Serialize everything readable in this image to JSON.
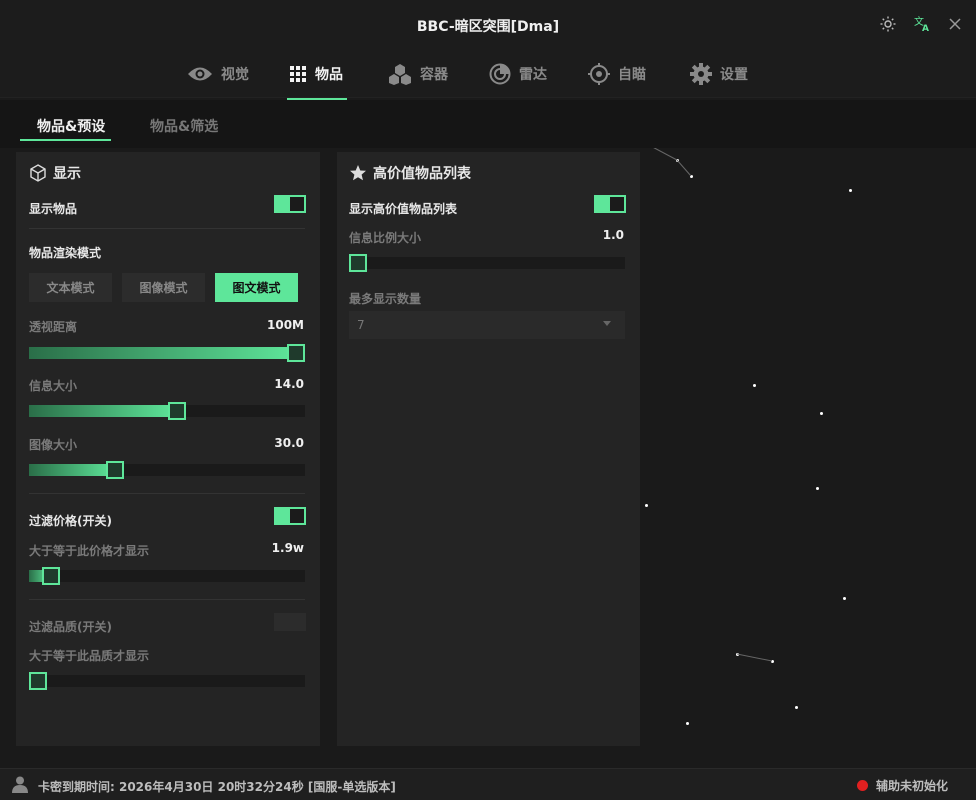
{
  "window": {
    "title": "BBC-暗区突围[Dma]"
  },
  "nav": {
    "items": [
      {
        "label": "视觉",
        "icon": "eye-icon"
      },
      {
        "label": "物品",
        "icon": "grid-icon"
      },
      {
        "label": "容器",
        "icon": "hexagons-icon"
      },
      {
        "label": "雷达",
        "icon": "radar-icon"
      },
      {
        "label": "自瞄",
        "icon": "crosshair-icon"
      },
      {
        "label": "设置",
        "icon": "gear-icon"
      }
    ],
    "active": "物品"
  },
  "subtabs": [
    {
      "label": "物品&预设"
    },
    {
      "label": "物品&筛选"
    }
  ],
  "display_panel": {
    "title": "显示",
    "show_items_label": "显示物品",
    "show_items_on": true,
    "render_mode_label": "物品渲染模式",
    "render_modes": [
      "文本模式",
      "图像模式",
      "图文模式"
    ],
    "render_mode_selected": "图文模式",
    "perspective_distance": {
      "label": "透视距离",
      "value": "100M",
      "fraction": 1.0
    },
    "info_size": {
      "label": "信息大小",
      "value": "14.0",
      "fraction": 0.54
    },
    "image_size": {
      "label": "图像大小",
      "value": "30.0",
      "fraction": 0.3
    },
    "filter_price": {
      "label": "过滤价格(开关)",
      "on": true
    },
    "min_price": {
      "label": "大于等于此价格才显示",
      "value": "1.9w",
      "fraction": 0.05
    },
    "filter_quality": {
      "label": "过滤品质(开关)",
      "on": false
    },
    "min_quality": {
      "label": "大于等于此品质才显示",
      "fraction": 0.0
    }
  },
  "high_value_panel": {
    "title": "高价值物品列表",
    "show_list_label": "显示高价值物品列表",
    "show_list_on": true,
    "info_scale": {
      "label": "信息比例大小",
      "value": "1.0",
      "fraction": 0.0
    },
    "max_count": {
      "label": "最多显示数量",
      "value": "7"
    }
  },
  "status": {
    "expiry_text": "卡密到期时间: 2026年4月30日  20时32分24秒 [国服-单选版本]",
    "assist_status": "辅助未初始化",
    "assist_status_color": "#e02020"
  },
  "colors": {
    "accent": "#5ee69a",
    "background": "#1a1a1a",
    "panel": "#242424"
  }
}
